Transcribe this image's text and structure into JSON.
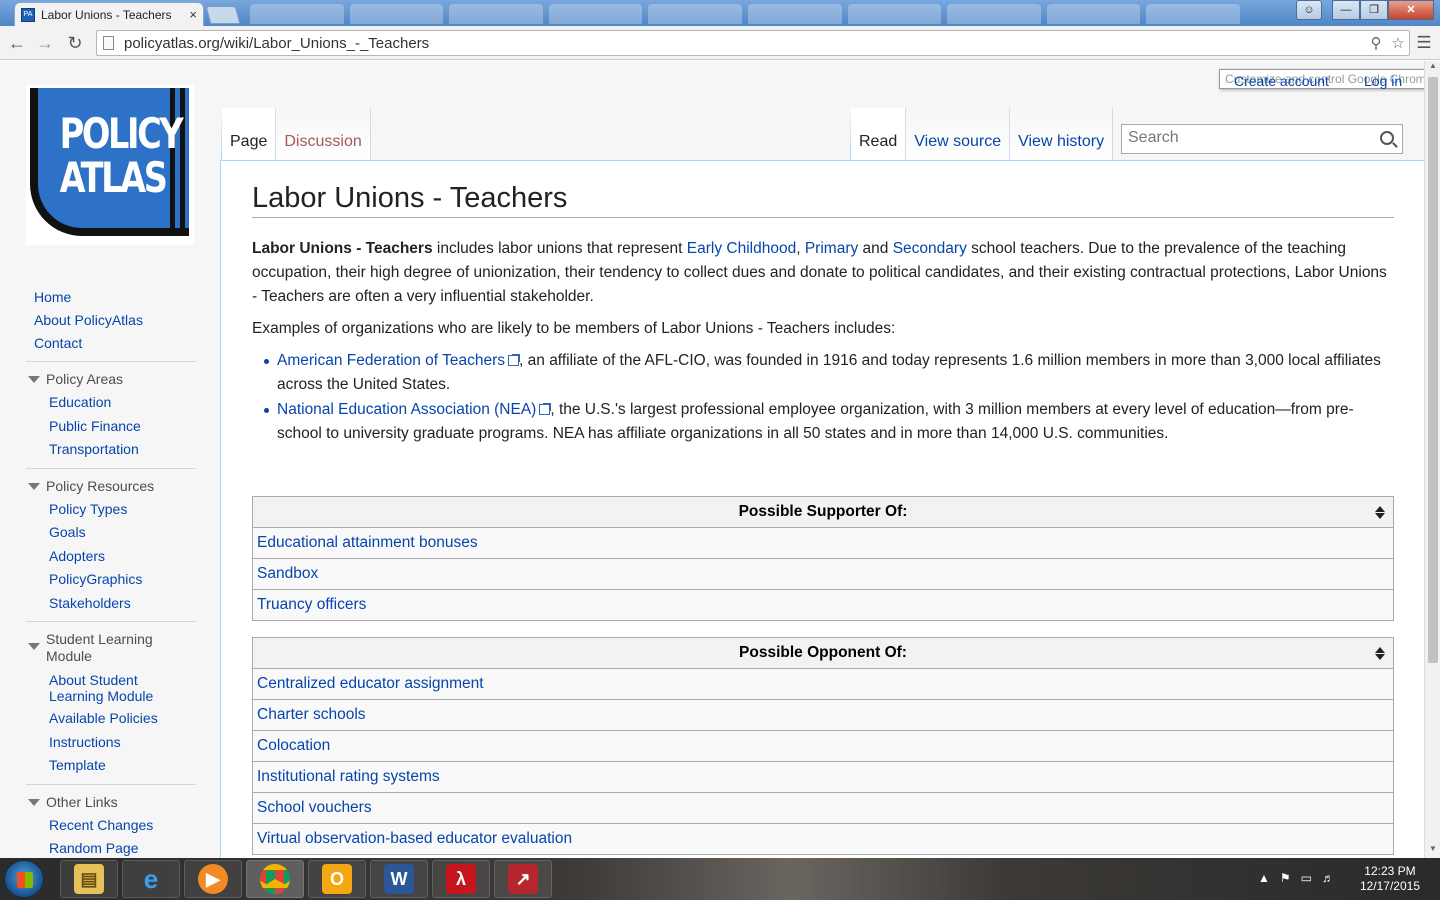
{
  "browser": {
    "tab_title": "Labor Unions - Teachers",
    "tab_close": "×",
    "url": "policyatlas.org/wiki/Labor_Unions_-_Teachers",
    "back": "←",
    "forward": "→",
    "reload": "↻"
  },
  "logo": {
    "text": "POLICY ATLAS"
  },
  "personal": {
    "tooltip": "Customize and control Google Chrome",
    "create_account": "Create account",
    "log_in": "Log in"
  },
  "tabs": {
    "page": "Page",
    "discussion": "Discussion",
    "read": "Read",
    "view_source": "View source",
    "view_history": "View history"
  },
  "search": {
    "placeholder": "Search"
  },
  "sidebar": {
    "top": [
      "Home",
      "About PolicyAtlas",
      "Contact"
    ],
    "sections": [
      {
        "heading": "Policy Areas",
        "items": [
          "Education",
          "Public Finance",
          "Transportation"
        ]
      },
      {
        "heading": "Policy Resources",
        "items": [
          "Policy Types",
          "Goals",
          "Adopters",
          "PolicyGraphics",
          "Stakeholders"
        ]
      },
      {
        "heading": "Student Learning Module",
        "items": [
          "About Student Learning Module",
          "Available Policies",
          "Instructions",
          "Template"
        ]
      },
      {
        "heading": "Other Links",
        "items": [
          "Recent Changes",
          "Random Page"
        ]
      }
    ]
  },
  "article": {
    "title": "Labor Unions - Teachers",
    "intro_bold": "Labor Unions - Teachers",
    "intro_1": " includes labor unions that represent ",
    "link_early": "Early Childhood",
    "comma": ", ",
    "link_primary": "Primary",
    "and": " and ",
    "link_secondary": "Secondary",
    "intro_2": " school teachers. Due to the prevalence of the teaching occupation, their high degree of unionization, their tendency to collect dues and donate to political candidates, and their existing contractual protections, Labor Unions - Teachers are often a very influential stakeholder.",
    "examples": "Examples of organizations who are likely to be members of Labor Unions - Teachers includes:",
    "org1_link": "American Federation of Teachers",
    "org1_text": ", an affiliate of the AFL-CIO, was founded in 1916 and today represents 1.6 million members in more than 3,000 local affiliates across the United States.",
    "org2_link": "National Education Association (NEA)",
    "org2_text": ", the U.S.'s largest professional employee organization, with 3 million members at every level of education—from pre-school to university graduate programs. NEA has affiliate organizations in all 50 states and in more than 14,000 U.S. communities."
  },
  "supporter_table": {
    "header": "Possible Supporter Of:",
    "rows": [
      "Educational attainment bonuses",
      "Sandbox",
      "Truancy officers"
    ]
  },
  "opponent_table": {
    "header": "Possible Opponent Of:",
    "rows": [
      "Centralized educator assignment",
      "Charter schools",
      "Colocation",
      "Institutional rating systems",
      "School vouchers",
      "Virtual observation-based educator evaluation"
    ]
  },
  "taskbar": {
    "time": "12:23 PM",
    "date": "12/17/2015"
  },
  "colors": {
    "link": "#0645ad",
    "border": "#a7d7f9"
  }
}
